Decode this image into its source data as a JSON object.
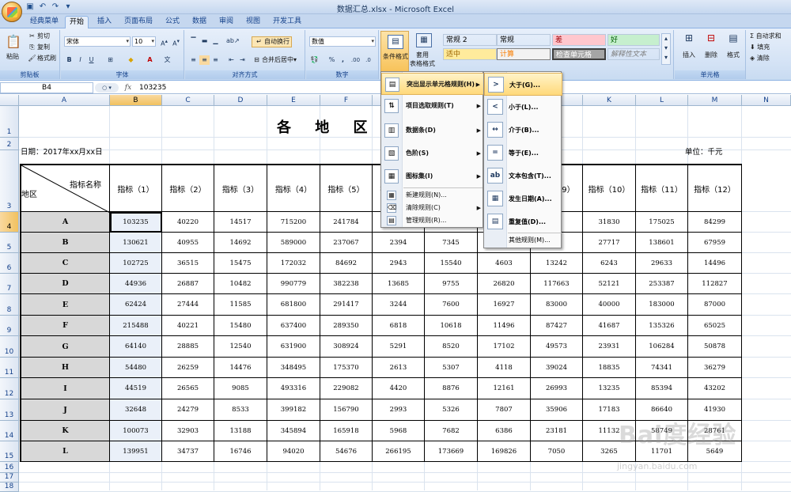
{
  "titlebar": {
    "title": "数据汇总.xlsx - Microsoft Excel"
  },
  "qat": [
    "save-icon",
    "undo-icon",
    "redo-icon",
    "customize-icon"
  ],
  "tabs": [
    "经典菜单",
    "开始",
    "插入",
    "页面布局",
    "公式",
    "数据",
    "审阅",
    "视图",
    "开发工具"
  ],
  "active_tab": "开始",
  "ribbon": {
    "clipboard": {
      "label": "剪贴板",
      "paste": "粘贴",
      "cut": "剪切",
      "copy": "复制",
      "format_painter": "格式刷"
    },
    "font": {
      "label": "字体",
      "font_name": "宋体",
      "font_size": "10"
    },
    "alignment": {
      "label": "对齐方式",
      "wrap": "自动换行",
      "merge": "合并后居中"
    },
    "number": {
      "label": "数字",
      "format": "数值"
    },
    "styles": {
      "conditional": "条件格式",
      "table_format_1": "套用",
      "table_format_2": "表格格式",
      "cells": [
        {
          "text": "常规 2",
          "bg": "#ffffff",
          "fg": "#000000"
        },
        {
          "text": "常规",
          "bg": "#ffffff",
          "fg": "#000000"
        },
        {
          "text": "差",
          "bg": "#ffc7ce",
          "fg": "#9c0006"
        },
        {
          "text": "好",
          "bg": "#c6efce",
          "fg": "#006100"
        },
        {
          "text": "适中",
          "bg": "#ffeb9c",
          "fg": "#9c6500"
        },
        {
          "text": "计算",
          "bg": "#f2f2f2",
          "fg": "#fa7d00"
        },
        {
          "text": "检查单元格",
          "bg": "#a5a5a5",
          "fg": "#ffffff"
        },
        {
          "text": "解释性文本",
          "bg": "#ffffff",
          "fg": "#7f7f7f"
        }
      ]
    },
    "cells": {
      "label": "单元格",
      "insert": "插入",
      "delete": "删除",
      "format": "格式"
    },
    "editing": {
      "autosum": "自动求和",
      "fill": "填充",
      "clear": "清除"
    }
  },
  "formula_bar": {
    "name_box": "B4",
    "fx": "fx",
    "value": "103235"
  },
  "columns": [
    "A",
    "B",
    "C",
    "D",
    "E",
    "F",
    "G",
    "H",
    "I",
    "J",
    "K",
    "L",
    "M",
    "N"
  ],
  "rows": [
    "1",
    "2",
    "3",
    "4",
    "5",
    "6",
    "7",
    "8",
    "9",
    "10",
    "11",
    "12",
    "13",
    "14",
    "15",
    "16",
    "17",
    "18"
  ],
  "sheet": {
    "title": "各 地 区 数",
    "date_label": "日期：2017年xx月xx日",
    "unit_label": "单位：千元",
    "corner_top": "指标名称",
    "corner_bottom": "地区",
    "headers": [
      "指标（1）",
      "指标（2）",
      "指标（3）",
      "指标（4）",
      "指标（5）",
      "指标（6）",
      "指标（7）",
      "指标（8）",
      "指标（9）",
      "指标（10）",
      "指标（11）",
      "指标（12）"
    ],
    "data": [
      {
        "region": "A",
        "values": [
          "103235",
          "40220",
          "14517",
          "715200",
          "241784",
          "",
          "",
          "",
          "55",
          "31830",
          "175025",
          "84299"
        ]
      },
      {
        "region": "B",
        "values": [
          "130621",
          "40955",
          "14692",
          "589000",
          "237067",
          "2394",
          "7345",
          "",
          "86",
          "27717",
          "138601",
          "67959"
        ]
      },
      {
        "region": "C",
        "values": [
          "102725",
          "36515",
          "15475",
          "172032",
          "84692",
          "2943",
          "15540",
          "4603",
          "13242",
          "6243",
          "29633",
          "14496"
        ]
      },
      {
        "region": "D",
        "values": [
          "44936",
          "26887",
          "10482",
          "990779",
          "382238",
          "13685",
          "9755",
          "26820",
          "117663",
          "52121",
          "253387",
          "112827"
        ]
      },
      {
        "region": "E",
        "values": [
          "62424",
          "27444",
          "11585",
          "681800",
          "291417",
          "3244",
          "7600",
          "16927",
          "83000",
          "40000",
          "183000",
          "87000"
        ]
      },
      {
        "region": "F",
        "values": [
          "215488",
          "40221",
          "15480",
          "637400",
          "289350",
          "6818",
          "10618",
          "11496",
          "87427",
          "41687",
          "135326",
          "65025"
        ]
      },
      {
        "region": "G",
        "values": [
          "64140",
          "28885",
          "12540",
          "631900",
          "308924",
          "5291",
          "8520",
          "17102",
          "49573",
          "23931",
          "106284",
          "50878"
        ]
      },
      {
        "region": "H",
        "values": [
          "54480",
          "26259",
          "14476",
          "348495",
          "175370",
          "2613",
          "5307",
          "4118",
          "39024",
          "18835",
          "74341",
          "36279"
        ]
      },
      {
        "region": "I",
        "values": [
          "44519",
          "26565",
          "9085",
          "493316",
          "229082",
          "4420",
          "8876",
          "12161",
          "26993",
          "13235",
          "85394",
          "43202"
        ]
      },
      {
        "region": "J",
        "values": [
          "32648",
          "24279",
          "8533",
          "399182",
          "156790",
          "2993",
          "5326",
          "7807",
          "35906",
          "17183",
          "86640",
          "41930"
        ]
      },
      {
        "region": "K",
        "values": [
          "100073",
          "32903",
          "13188",
          "345894",
          "165918",
          "5968",
          "7682",
          "6386",
          "23181",
          "11132",
          "58749",
          "28761"
        ]
      },
      {
        "region": "L",
        "values": [
          "139951",
          "34737",
          "16746",
          "94020",
          "54676",
          "266195",
          "173669",
          "169826",
          "7050",
          "3265",
          "11701",
          "5649"
        ]
      }
    ]
  },
  "cf_menu": [
    {
      "label": "突出显示单元格规则(H)",
      "icon": "highlight-rules-icon",
      "sub": true,
      "highlighted": true
    },
    {
      "label": "项目选取规则(T)",
      "icon": "top-bottom-icon",
      "sub": true
    },
    {
      "label": "数据条(D)",
      "icon": "databar-icon",
      "sub": true
    },
    {
      "label": "色阶(S)",
      "icon": "colorscale-icon",
      "sub": true
    },
    {
      "label": "图标集(I)",
      "icon": "iconset-icon",
      "sub": true
    },
    {
      "label": "新建规则(N)...",
      "icon": "new-rule-icon",
      "sub": false
    },
    {
      "label": "清除规则(C)",
      "icon": "clear-rule-icon",
      "sub": true
    },
    {
      "label": "管理规则(R)...",
      "icon": "manage-rule-icon",
      "sub": false
    }
  ],
  "highlight_menu": [
    {
      "label": "大于(G)...",
      "icon": "greater-than-icon",
      "highlighted": true
    },
    {
      "label": "小于(L)...",
      "icon": "less-than-icon"
    },
    {
      "label": "介于(B)...",
      "icon": "between-icon"
    },
    {
      "label": "等于(E)...",
      "icon": "equal-to-icon"
    },
    {
      "label": "文本包含(T)...",
      "icon": "text-contains-icon"
    },
    {
      "label": "发生日期(A)...",
      "icon": "date-occurring-icon"
    },
    {
      "label": "重复值(D)...",
      "icon": "duplicate-values-icon"
    },
    {
      "label": "其他规则(M)...",
      "icon": "more-rules-icon"
    }
  ],
  "watermark": {
    "brand": "Bai度经验",
    "url": "jingyan.baidu.com"
  }
}
